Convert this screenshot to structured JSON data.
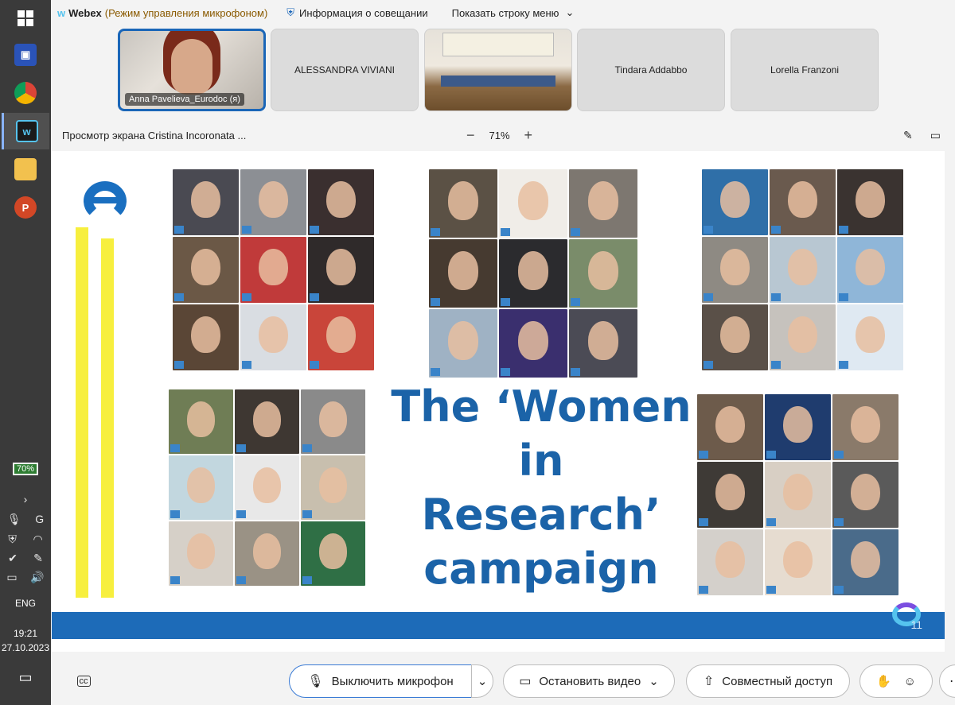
{
  "taskbar": {
    "battery": "70%",
    "language": "ENG",
    "time": "19:21",
    "date": "27.10.2023"
  },
  "header": {
    "app_name": "Webex",
    "mode": "(Режим управления микрофоном)",
    "meeting_info": "Информация о совещании",
    "menu_toggle": "Показать строку меню"
  },
  "participants": [
    {
      "name": "Anna Pavelieva_Eurodoc (я)"
    },
    {
      "name": "ALESSANDRA VIVIANI"
    },
    {
      "name": ""
    },
    {
      "name": "Tindara Addabbo"
    },
    {
      "name": "Lorella Franzoni"
    }
  ],
  "share": {
    "title": "Просмотр экрана Cristina Incoronata ...",
    "zoom": "71%"
  },
  "slide": {
    "title_lines": [
      "The ‘Women",
      "in",
      "Research’",
      "campaign"
    ],
    "page_number": "11",
    "colors": {
      "accent": "#1b63a8",
      "band": "#1d6bb8",
      "stripe": "#f7ef3e"
    }
  },
  "controls": {
    "mute_label": "Выключить микрофон",
    "video_label": "Остановить видео",
    "share_label": "Совместный доступ"
  }
}
